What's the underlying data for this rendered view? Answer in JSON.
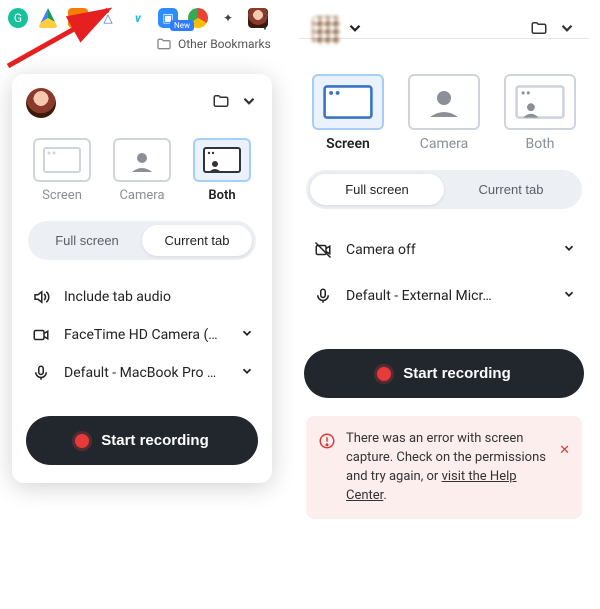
{
  "toolbar": {
    "overflow_glyph": "⋮",
    "bookmarks_label": "Other Bookmarks",
    "new_badge": "New",
    "icons": [
      "grammarly-icon",
      "google-drive-icon",
      "analytics-icon",
      "sentry-icon",
      "vimeo-icon",
      "zoom-icon",
      "chrome-icon",
      "puzzle-icon",
      "avatar-icon"
    ]
  },
  "left": {
    "modes": {
      "screen": "Screen",
      "camera": "Camera",
      "both": "Both",
      "selected": "both"
    },
    "seg": {
      "full": "Full screen",
      "tab": "Current tab",
      "selected": "tab"
    },
    "audio": "Include tab audio",
    "camera_opt": "FaceTime HD Camera (…",
    "mic_opt": "Default - MacBook Pro …",
    "start": "Start recording"
  },
  "right": {
    "modes": {
      "screen": "Screen",
      "camera": "Camera",
      "both": "Both",
      "selected": "screen"
    },
    "seg": {
      "full": "Full screen",
      "tab": "Current tab",
      "selected": "full"
    },
    "camera_opt": "Camera off",
    "mic_opt": "Default - External Micr…",
    "start": "Start recording",
    "error": {
      "text_pre": "There was an error with screen capture. Check on the permissions and try again, or ",
      "link": "visit the Help Center",
      "text_post": "."
    }
  },
  "glyph": {
    "chev": "⌄"
  }
}
